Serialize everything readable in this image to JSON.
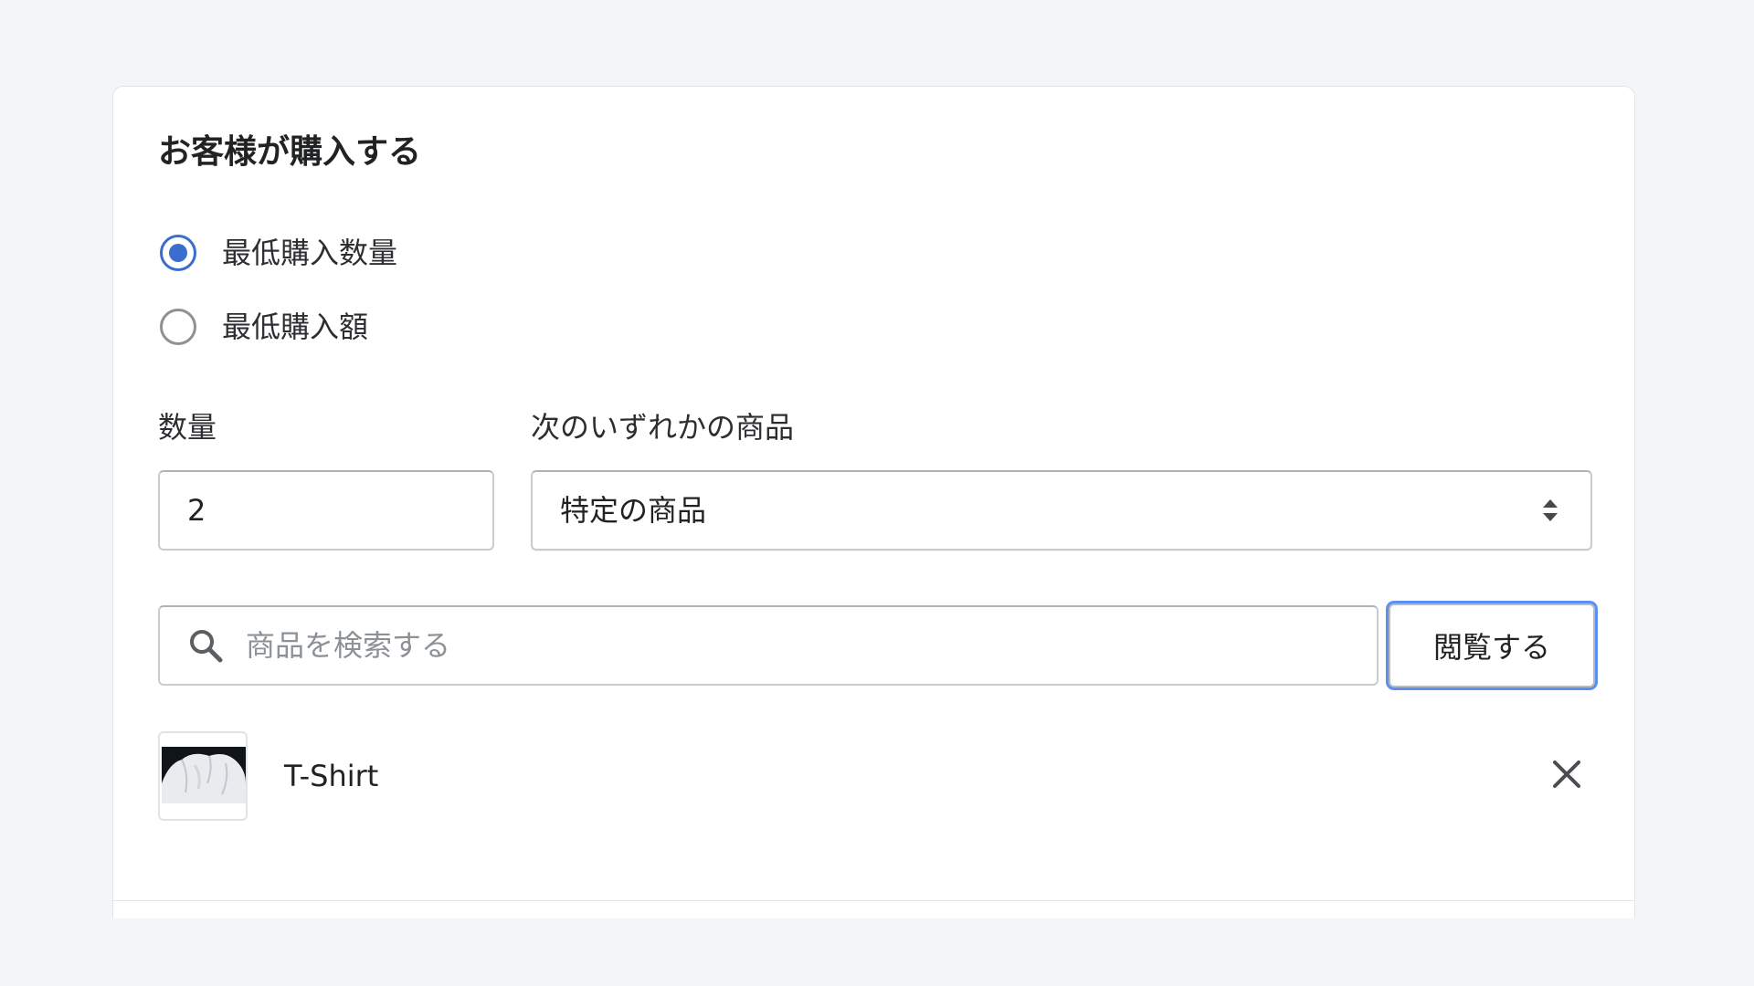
{
  "card": {
    "title": "お客様が購入する"
  },
  "purchase_condition": {
    "options": [
      {
        "label": "最低購入数量",
        "selected": true
      },
      {
        "label": "最低購入額",
        "selected": false
      }
    ]
  },
  "quantity": {
    "label": "数量",
    "value": "2"
  },
  "applies_to": {
    "label": "次のいずれかの商品",
    "selected": "特定の商品"
  },
  "product_search": {
    "placeholder": "商品を検索する",
    "browse_label": "閲覧する"
  },
  "selected_products": [
    {
      "name": "T-Shirt"
    }
  ],
  "icons": {
    "search": "search-icon",
    "select_arrows": "select-arrows-icon",
    "remove": "close-icon"
  },
  "colors": {
    "accent": "#3b6ccf",
    "focus_ring": "#5b8ff0",
    "background": "#f4f5f7"
  }
}
